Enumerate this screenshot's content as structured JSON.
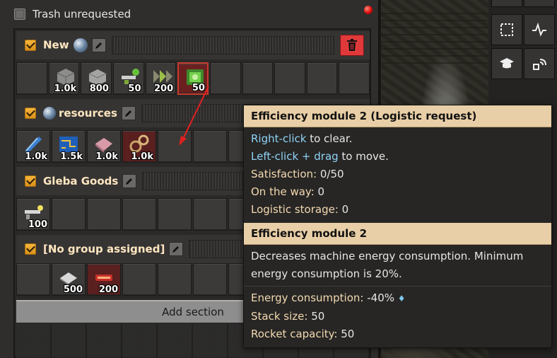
{
  "panel": {
    "trash_label": "Trash unrequested"
  },
  "sections": [
    {
      "title": "New",
      "has_planet": true,
      "items": [
        {
          "icon": "stone-brick-icon",
          "qty": "1.0k"
        },
        {
          "icon": "concrete-icon",
          "qty": "800"
        },
        {
          "icon": "inserter-icon",
          "qty": "50"
        },
        {
          "icon": "belt-icon",
          "qty": "200"
        },
        {
          "icon": "efficiency-module-2-icon",
          "qty": "50"
        }
      ]
    },
    {
      "title": "resources",
      "has_planet": true,
      "items": [
        {
          "icon": "blue-plate-icon",
          "qty": "1.0k"
        },
        {
          "icon": "circuit-icon",
          "qty": "1.5k"
        },
        {
          "icon": "pink-sheet-icon",
          "qty": "1.0k"
        },
        {
          "icon": "gear-cluster-icon",
          "qty": "1.0k"
        }
      ]
    },
    {
      "title": "Gleba Goods",
      "has_planet": false,
      "items": [
        {
          "icon": "wrench-inserter-icon",
          "qty": "100"
        }
      ]
    },
    {
      "title": "[No group assigned]",
      "has_planet": false,
      "items": [
        {
          "icon": "silver-stone-icon",
          "qty": "500"
        },
        {
          "icon": "red-heater-icon",
          "qty": "200"
        }
      ]
    }
  ],
  "add_section_label": "Add section",
  "tooltip": {
    "title1": "Efficiency module 2 (Logistic request)",
    "right_click": "Right-click",
    "right_click_rest": " to clear.",
    "left_click": "Left-click + drag",
    "left_click_rest": " to move.",
    "satisfaction_label": "Satisfaction: ",
    "satisfaction_value": "0/50",
    "on_the_way_label": "On the way: ",
    "on_the_way_value": "0",
    "logistic_storage_label": "Logistic storage: ",
    "logistic_storage_value": "0",
    "title2": "Efficiency module 2",
    "description": "Decreases machine energy consumption. Minimum energy consumption is 20%.",
    "energy_label": "Energy consumption: ",
    "energy_value": "-40%",
    "stack_label": "Stack size: ",
    "stack_value": "50",
    "rocket_label": "Rocket capacity: ",
    "rocket_value": "50"
  },
  "colors": {
    "accent_orange": "#f7b73b",
    "delete_red": "#e0393b",
    "tooltip_header": "#e9cfa7",
    "hint_blue": "#8fd3f5"
  }
}
